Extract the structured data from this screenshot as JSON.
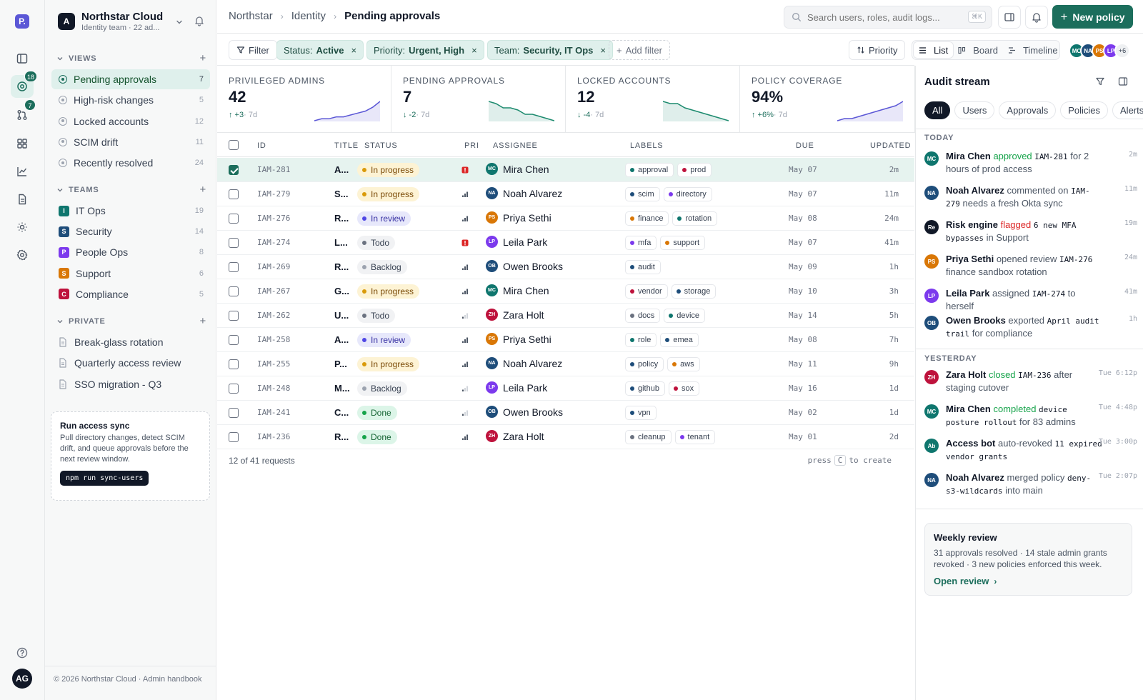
{
  "rail": {
    "logo": "P.",
    "items": [
      {
        "name": "inbox-icon"
      },
      {
        "name": "target-icon",
        "badge": "18",
        "active": true
      },
      {
        "name": "pull-request-icon",
        "badge": "7"
      },
      {
        "name": "grid-icon"
      },
      {
        "name": "chart-icon"
      },
      {
        "name": "document-icon"
      },
      {
        "name": "sun-icon"
      },
      {
        "name": "settings-icon"
      }
    ],
    "help_icon": "help-icon",
    "user_initials": "AG"
  },
  "sidebar": {
    "org_initial": "A",
    "org_name": "Northstar Cloud",
    "org_sub": "Identity team · 22 ad...",
    "views_title": "VIEWS",
    "views": [
      {
        "label": "Pending approvals",
        "count": "7",
        "active": true
      },
      {
        "label": "High-risk changes",
        "count": "5"
      },
      {
        "label": "Locked accounts",
        "count": "12"
      },
      {
        "label": "SCIM drift",
        "count": "11"
      },
      {
        "label": "Recently resolved",
        "count": "24"
      }
    ],
    "teams_title": "TEAMS",
    "teams": [
      {
        "initial": "I",
        "label": "IT Ops",
        "count": "19",
        "color": "#0f766e"
      },
      {
        "initial": "S",
        "label": "Security",
        "count": "14",
        "color": "#1e4d7a"
      },
      {
        "initial": "P",
        "label": "People Ops",
        "count": "8",
        "color": "#7c3aed"
      },
      {
        "initial": "S",
        "label": "Support",
        "count": "6",
        "color": "#d97706"
      },
      {
        "initial": "C",
        "label": "Compliance",
        "count": "5",
        "color": "#be123c"
      }
    ],
    "private_title": "PRIVATE",
    "private": [
      {
        "label": "Break-glass rotation"
      },
      {
        "label": "Quarterly access review"
      },
      {
        "label": "SSO migration - Q3"
      }
    ],
    "sync": {
      "title": "Run access sync",
      "body": "Pull directory changes, detect SCIM drift, and queue approvals before the next review window.",
      "command": "npm run sync-users"
    },
    "footer": "© 2026 Northstar Cloud · Admin handbook"
  },
  "topbar": {
    "breadcrumbs": [
      "Northstar",
      "Identity",
      "Pending approvals"
    ],
    "search_placeholder": "Search users, roles, audit logs...",
    "search_shortcut": "⌘K",
    "new_button": "New policy"
  },
  "filters": {
    "filter_label": "Filter",
    "chips": [
      {
        "key": "Status:",
        "value": "Active"
      },
      {
        "key": "Priority:",
        "value": "Urgent, High"
      },
      {
        "key": "Team:",
        "value": "Security, IT Ops"
      }
    ],
    "add_filter": "Add filter",
    "sort_label": "Priority",
    "views": [
      {
        "label": "List",
        "active": true
      },
      {
        "label": "Board"
      },
      {
        "label": "Timeline"
      }
    ],
    "avatars": [
      {
        "initials": "MC",
        "color": "#0f766e"
      },
      {
        "initials": "NA",
        "color": "#1e4d7a"
      },
      {
        "initials": "PS",
        "color": "#d97706"
      },
      {
        "initials": "LP",
        "color": "#7c3aed"
      }
    ],
    "more_avatars": "+6"
  },
  "metrics": [
    {
      "label": "PRIVILEGED ADMINS",
      "value": "42",
      "delta": "↑ +3",
      "period": "· 7d",
      "trend": "up",
      "color": "#5b57d6",
      "spark": [
        2,
        3,
        3,
        4,
        4,
        5,
        6,
        7,
        9,
        12
      ]
    },
    {
      "label": "PENDING APPROVALS",
      "value": "7",
      "delta": "↓ -2",
      "period": "· 7d",
      "trend": "down",
      "color": "#1c8a6e",
      "spark": [
        12,
        11,
        9,
        9,
        8,
        6,
        6,
        5,
        4,
        3
      ]
    },
    {
      "label": "LOCKED ACCOUNTS",
      "value": "12",
      "delta": "↓ -4",
      "period": "· 7d",
      "trend": "down",
      "color": "#1c8a6e",
      "spark": [
        12,
        11,
        11,
        9,
        8,
        7,
        6,
        5,
        4,
        3
      ]
    },
    {
      "label": "POLICY COVERAGE",
      "value": "94%",
      "delta": "↑ +6%",
      "period": "· 7d",
      "trend": "up",
      "color": "#5b57d6",
      "spark": [
        2,
        3,
        3,
        4,
        5,
        6,
        7,
        8,
        9,
        11
      ]
    }
  ],
  "table": {
    "headers": {
      "id": "ID",
      "title": "TITLE",
      "status": "STATUS",
      "pri": "PRI",
      "assignee": "ASSIGNEE",
      "labels": "LABELS",
      "due": "DUE",
      "updated": "UPDATED"
    },
    "rows": [
      {
        "id": "IAM-281",
        "title": "A...",
        "status": "In progress",
        "priority": "urgent",
        "assignee": "Mira Chen",
        "initials": "MC",
        "avatar_color": "#0f766e",
        "labels": [
          {
            "t": "approval",
            "c": "#0f766e"
          },
          {
            "t": "prod",
            "c": "#be123c"
          }
        ],
        "due": "May 07",
        "updated": "2m",
        "selected": true
      },
      {
        "id": "IAM-279",
        "title": "S...",
        "status": "In progress",
        "priority": "high",
        "assignee": "Noah Alvarez",
        "initials": "NA",
        "avatar_color": "#1e4d7a",
        "labels": [
          {
            "t": "scim",
            "c": "#1e4d7a"
          },
          {
            "t": "directory",
            "c": "#7c3aed"
          }
        ],
        "due": "May 07",
        "updated": "11m"
      },
      {
        "id": "IAM-276",
        "title": "R...",
        "status": "In review",
        "priority": "high",
        "assignee": "Priya Sethi",
        "initials": "PS",
        "avatar_color": "#d97706",
        "labels": [
          {
            "t": "finance",
            "c": "#d97706"
          },
          {
            "t": "rotation",
            "c": "#0f766e"
          }
        ],
        "due": "May 08",
        "updated": "24m"
      },
      {
        "id": "IAM-274",
        "title": "L...",
        "status": "Todo",
        "priority": "urgent",
        "assignee": "Leila Park",
        "initials": "LP",
        "avatar_color": "#7c3aed",
        "labels": [
          {
            "t": "mfa",
            "c": "#7c3aed"
          },
          {
            "t": "support",
            "c": "#d97706"
          }
        ],
        "due": "May 07",
        "updated": "41m"
      },
      {
        "id": "IAM-269",
        "title": "R...",
        "status": "Backlog",
        "priority": "high",
        "assignee": "Owen Brooks",
        "initials": "OB",
        "avatar_color": "#1e4d7a",
        "labels": [
          {
            "t": "audit",
            "c": "#1e4d7a"
          }
        ],
        "due": "May 09",
        "updated": "1h"
      },
      {
        "id": "IAM-267",
        "title": "G...",
        "status": "In progress",
        "priority": "high",
        "assignee": "Mira Chen",
        "initials": "MC",
        "avatar_color": "#0f766e",
        "labels": [
          {
            "t": "vendor",
            "c": "#be123c"
          },
          {
            "t": "storage",
            "c": "#1e4d7a"
          }
        ],
        "due": "May 10",
        "updated": "3h"
      },
      {
        "id": "IAM-262",
        "title": "U...",
        "status": "Todo",
        "priority": "low",
        "assignee": "Zara Holt",
        "initials": "ZH",
        "avatar_color": "#be123c",
        "labels": [
          {
            "t": "docs",
            "c": "#6b7280"
          },
          {
            "t": "device",
            "c": "#0f766e"
          }
        ],
        "due": "May 14",
        "updated": "5h"
      },
      {
        "id": "IAM-258",
        "title": "A...",
        "status": "In review",
        "priority": "high",
        "assignee": "Priya Sethi",
        "initials": "PS",
        "avatar_color": "#d97706",
        "labels": [
          {
            "t": "role",
            "c": "#0f766e"
          },
          {
            "t": "emea",
            "c": "#1e4d7a"
          }
        ],
        "due": "May 08",
        "updated": "7h"
      },
      {
        "id": "IAM-255",
        "title": "P...",
        "status": "In progress",
        "priority": "high",
        "assignee": "Noah Alvarez",
        "initials": "NA",
        "avatar_color": "#1e4d7a",
        "labels": [
          {
            "t": "policy",
            "c": "#1e4d7a"
          },
          {
            "t": "aws",
            "c": "#d97706"
          }
        ],
        "due": "May 11",
        "updated": "9h"
      },
      {
        "id": "IAM-248",
        "title": "M...",
        "status": "Backlog",
        "priority": "low",
        "assignee": "Leila Park",
        "initials": "LP",
        "avatar_color": "#7c3aed",
        "labels": [
          {
            "t": "github",
            "c": "#1e4d7a"
          },
          {
            "t": "sox",
            "c": "#be123c"
          }
        ],
        "due": "May 16",
        "updated": "1d"
      },
      {
        "id": "IAM-241",
        "title": "C...",
        "status": "Done",
        "priority": "low",
        "assignee": "Owen Brooks",
        "initials": "OB",
        "avatar_color": "#1e4d7a",
        "labels": [
          {
            "t": "vpn",
            "c": "#1e4d7a"
          }
        ],
        "due": "May 02",
        "updated": "1d"
      },
      {
        "id": "IAM-236",
        "title": "R...",
        "status": "Done",
        "priority": "high",
        "assignee": "Zara Holt",
        "initials": "ZH",
        "avatar_color": "#be123c",
        "labels": [
          {
            "t": "cleanup",
            "c": "#6b7280"
          },
          {
            "t": "tenant",
            "c": "#7c3aed"
          }
        ],
        "due": "May 01",
        "updated": "2d"
      }
    ],
    "footer_count": "12 of 41 requests",
    "footer_hint_a": "press",
    "footer_hint_key": "C",
    "footer_hint_b": "to create"
  },
  "status_styles": {
    "In progress": {
      "bg": "#fdf3d4",
      "dot": "#d99a0a",
      "fg": "#7a4a07"
    },
    "In review": {
      "bg": "#e7e8fb",
      "dot": "#4f46e5",
      "fg": "#3730a3"
    },
    "Todo": {
      "bg": "#f1f2f4",
      "dot": "#6b7280",
      "fg": "#374151"
    },
    "Backlog": {
      "bg": "#f1f2f4",
      "dot": "#9ca3af",
      "fg": "#374151"
    },
    "Done": {
      "bg": "#dcf5e8",
      "dot": "#16a34a",
      "fg": "#166534"
    }
  },
  "audit": {
    "title": "Audit stream",
    "tabs": [
      {
        "label": "All",
        "active": true
      },
      {
        "label": "Users"
      },
      {
        "label": "Approvals"
      },
      {
        "label": "Policies"
      },
      {
        "label": "Alerts"
      }
    ],
    "today_title": "TODAY",
    "yesterday_title": "YESTERDAY",
    "events": [
      {
        "initials": "MC",
        "color": "#0f766e",
        "parts": [
          {
            "t": "Mira Chen",
            "k": "who"
          },
          {
            "t": " approved ",
            "k": "green"
          },
          {
            "t": "IAM-281",
            "k": "mono"
          },
          {
            "t": " for 2 hours of prod access",
            "k": "txt"
          }
        ],
        "time": "2m"
      },
      {
        "initials": "NA",
        "color": "#1e4d7a",
        "parts": [
          {
            "t": "Noah Alvarez",
            "k": "who"
          },
          {
            "t": " commented on ",
            "k": "txt"
          },
          {
            "t": "IAM-279",
            "k": "mono"
          },
          {
            "t": " needs a fresh Okta sync",
            "k": "txt"
          }
        ],
        "time": "11m"
      },
      {
        "initials": "Re",
        "color": "#111827",
        "parts": [
          {
            "t": "Risk engine",
            "k": "who"
          },
          {
            "t": " flagged ",
            "k": "red"
          },
          {
            "t": "6 new MFA bypasses",
            "k": "mono"
          },
          {
            "t": " in Support",
            "k": "txt"
          }
        ],
        "time": "19m"
      },
      {
        "initials": "PS",
        "color": "#d97706",
        "parts": [
          {
            "t": "Priya Sethi",
            "k": "who"
          },
          {
            "t": " opened review ",
            "k": "txt"
          },
          {
            "t": "IAM-276",
            "k": "mono"
          },
          {
            "t": " finance sandbox rotation",
            "k": "txt"
          }
        ],
        "time": "24m"
      },
      {
        "initials": "LP",
        "color": "#7c3aed",
        "parts": [
          {
            "t": "Leila Park",
            "k": "who"
          },
          {
            "t": " assigned ",
            "k": "txt"
          },
          {
            "t": "IAM-274",
            "k": "mono"
          },
          {
            "t": " to herself",
            "k": "txt"
          }
        ],
        "time": "41m"
      },
      {
        "initials": "OB",
        "color": "#1e4d7a",
        "parts": [
          {
            "t": "Owen Brooks",
            "k": "who"
          },
          {
            "t": " exported ",
            "k": "txt"
          },
          {
            "t": "April audit trail",
            "k": "mono"
          },
          {
            "t": " for compliance",
            "k": "txt"
          }
        ],
        "time": "1h"
      },
      {
        "initials": "ZH",
        "color": "#be123c",
        "parts": [
          {
            "t": "Zara Holt",
            "k": "who"
          },
          {
            "t": " closed ",
            "k": "green"
          },
          {
            "t": "IAM-236",
            "k": "mono"
          },
          {
            "t": " after staging cutover",
            "k": "txt"
          }
        ],
        "time": "Tue 6:12p"
      },
      {
        "initials": "MC",
        "color": "#0f766e",
        "parts": [
          {
            "t": "Mira Chen",
            "k": "who"
          },
          {
            "t": " completed ",
            "k": "green"
          },
          {
            "t": "device posture rollout",
            "k": "mono"
          },
          {
            "t": " for 83 admins",
            "k": "txt"
          }
        ],
        "time": "Tue 4:48p"
      },
      {
        "initials": "Ab",
        "color": "#0f766e",
        "parts": [
          {
            "t": "Access bot",
            "k": "who"
          },
          {
            "t": " auto-revoked ",
            "k": "txt"
          },
          {
            "t": "11 expired vendor grants",
            "k": "mono"
          }
        ],
        "time": "Tue 3:00p"
      },
      {
        "initials": "NA",
        "color": "#1e4d7a",
        "parts": [
          {
            "t": "Noah Alvarez",
            "k": "who"
          },
          {
            "t": " merged policy ",
            "k": "txt"
          },
          {
            "t": "deny-s3-wildcards",
            "k": "mono"
          },
          {
            "t": " into main",
            "k": "txt"
          }
        ],
        "time": "Tue 2:07p"
      }
    ],
    "weekly": {
      "title": "Weekly review",
      "body": "31 approvals resolved · 14 stale admin grants revoked · 3 new policies enforced this week.",
      "link": "Open review"
    }
  }
}
